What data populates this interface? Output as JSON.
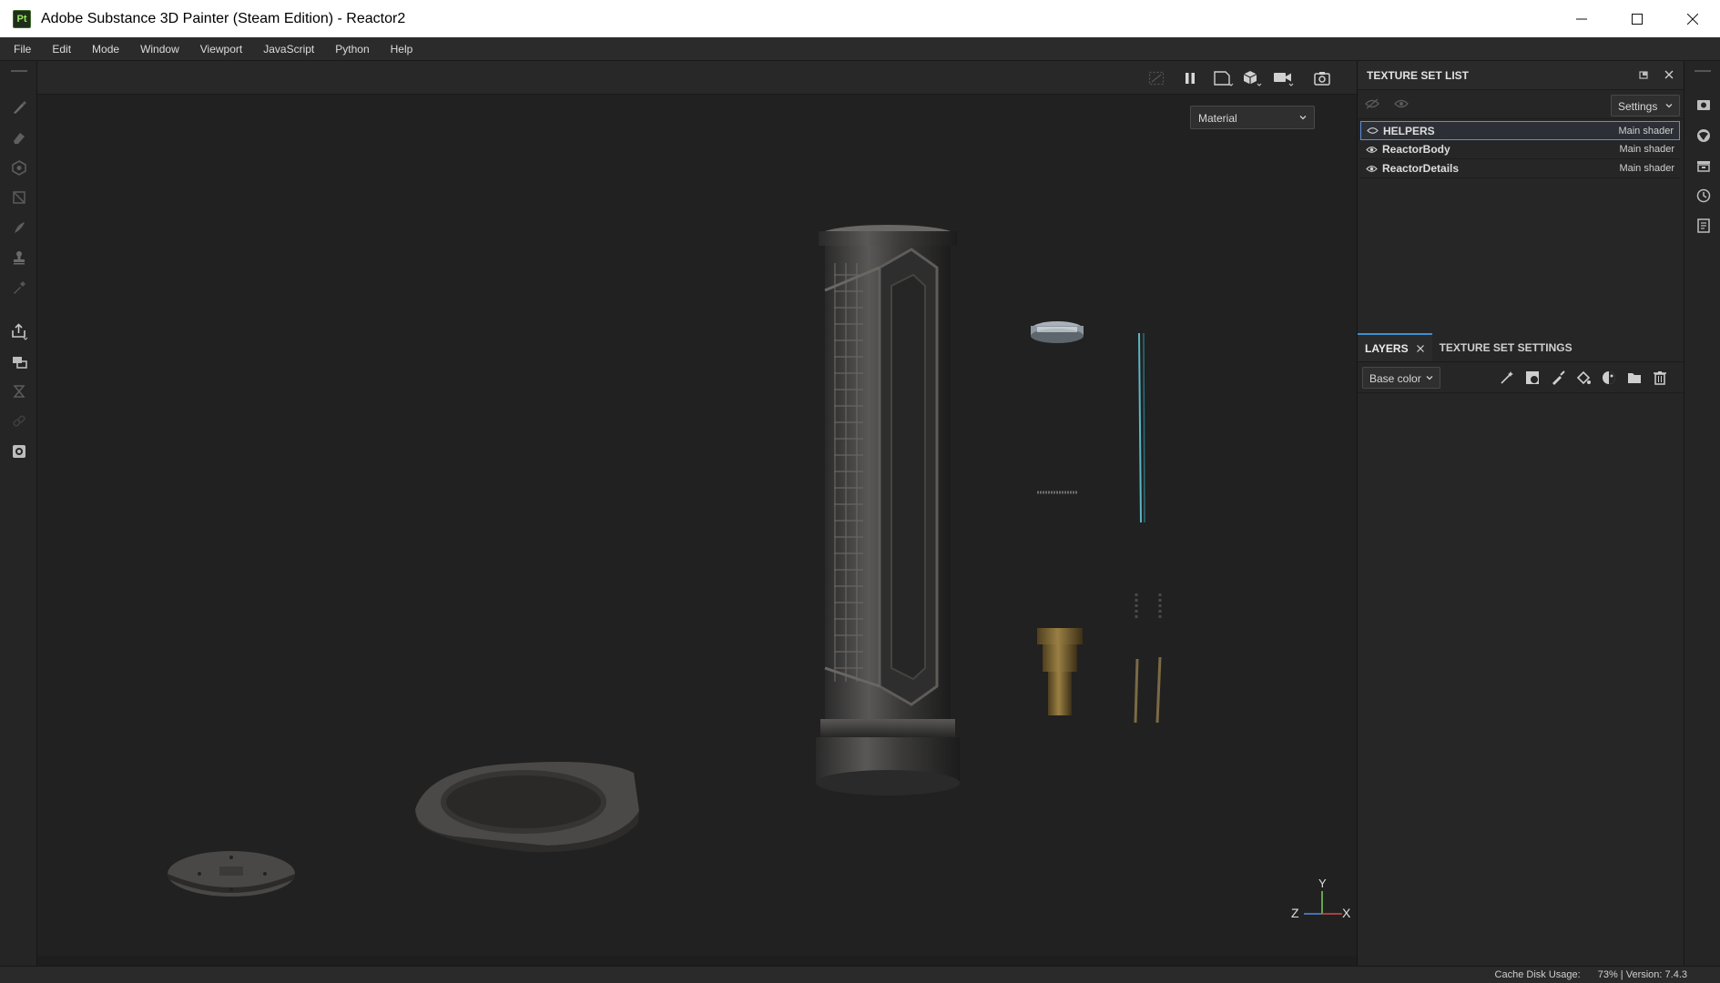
{
  "window": {
    "title": "Adobe Substance 3D Painter (Steam Edition) - Reactor2",
    "logo": "Pt"
  },
  "menu": [
    "File",
    "Edit",
    "Mode",
    "Window",
    "Viewport",
    "JavaScript",
    "Python",
    "Help"
  ],
  "viewport": {
    "display_mode": "Material",
    "axis_labels": {
      "y": "Y",
      "z": "Z",
      "x": "X"
    }
  },
  "texture_set_list": {
    "title": "TEXTURE SET LIST",
    "settings_label": "Settings",
    "items": [
      {
        "name": "HELPERS",
        "shader": "Main shader",
        "visible": false,
        "selected": true
      },
      {
        "name": "ReactorBody",
        "shader": "Main shader",
        "visible": true,
        "selected": false
      },
      {
        "name": "ReactorDetails",
        "shader": "Main shader",
        "visible": true,
        "selected": false
      }
    ]
  },
  "layers": {
    "tabs": [
      "LAYERS",
      "TEXTURE SET SETTINGS"
    ],
    "channel": "Base color"
  },
  "status": {
    "cache_label": "Cache Disk Usage:",
    "cache_value": "73% | Version: 7.4.3"
  },
  "colors": {
    "accent_blue": "#3e8ed0",
    "selection_border": "#5c8fd6",
    "logo_green": "#9be564"
  }
}
